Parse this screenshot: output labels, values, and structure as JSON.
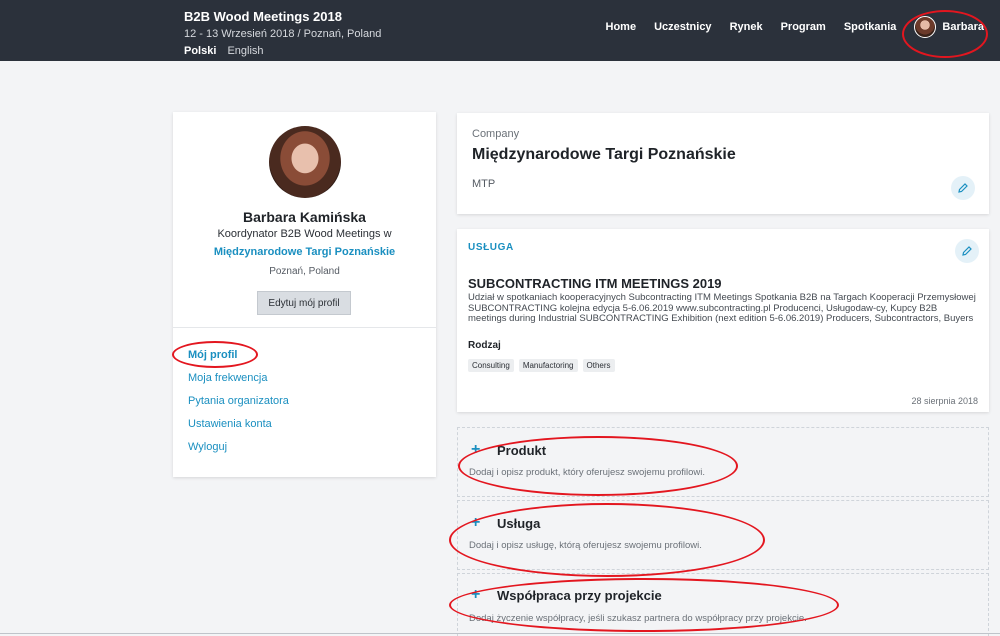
{
  "header": {
    "title": "B2B Wood Meetings 2018",
    "subtitle": "12 - 13 Wrzesień 2018 / Poznań, Poland",
    "languages": [
      "Polski",
      "English"
    ],
    "nav": [
      "Home",
      "Uczestnicy",
      "Rynek",
      "Program",
      "Spotkania"
    ],
    "user_name": "Barbara"
  },
  "profile": {
    "name": "Barbara Kamińska",
    "role": "Koordynator B2B Wood Meetings w",
    "company": "Międzynarodowe Targi Poznańskie",
    "city": "Poznań, Poland",
    "edit_label": "Edytuj mój profil",
    "menu": [
      "Mój profil",
      "Moja frekwencja",
      "Pytania organizatora",
      "Ustawienia konta",
      "Wyloguj"
    ]
  },
  "company_card": {
    "label": "Company",
    "name": "Międzynarodowe Targi Poznańskie",
    "short": "MTP"
  },
  "service_card": {
    "kind": "USŁUGA",
    "title": "SUBCONTRACTING ITM MEETINGS 2019",
    "description": "Udział w spotkaniach kooperacyjnych Subcontracting ITM Meetings Spotkania B2B na Targach Kooperacji Przemysłowej SUBCONTRACTING kolejna edycja 5-6.06.2019 www.subcontracting.pl Producenci, Usługodaw-cy, Kupcy B2B meetings during Industrial SUBCONTRACTING Exhibition (next edition 5-6.06.2019) Producers, Subcontractors, Buyers",
    "type_label": "Rodzaj",
    "tags": [
      "Consulting",
      "Manufactoring",
      "Others"
    ],
    "date": "28 sierpnia 2018"
  },
  "add_boxes": [
    {
      "title": "Produkt",
      "desc": "Dodaj i opisz produkt, który oferujesz swojemu profilowi."
    },
    {
      "title": "Usługa",
      "desc": "Dodaj i opisz usługę, którą oferujesz swojemu profilowi."
    },
    {
      "title": "Współpraca przy projekcie",
      "desc": "Dodaj życzenie współpracy, jeśli szukasz partnera do współpracy przy projekcie."
    }
  ],
  "colors": {
    "topbar": "#2b313b",
    "accent": "#1a8fc0",
    "annotation": "#e3161f"
  }
}
